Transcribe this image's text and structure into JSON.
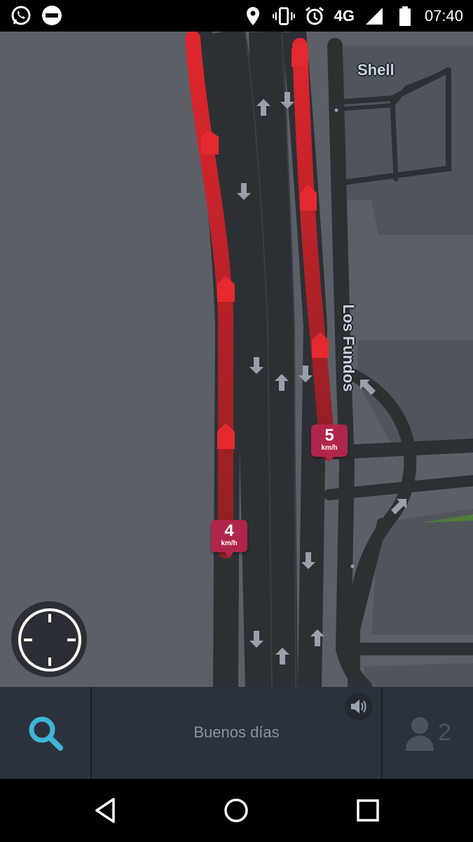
{
  "status_bar": {
    "left_icons": [
      "whatsapp-icon",
      "do-not-disturb-icon"
    ],
    "right_icons": [
      "location-icon",
      "vibrate-icon",
      "alarm-icon"
    ],
    "network": "4G",
    "time": "07:40"
  },
  "map": {
    "labels": {
      "shell": "Shell",
      "los_fundos": "Los Fundos"
    },
    "traffic_reports": [
      {
        "speed": "5",
        "unit": "km/h"
      },
      {
        "speed": "4",
        "unit": "km/h"
      }
    ],
    "colors": {
      "background": "#5b6066",
      "road": "#2c3035",
      "traffic_jam": "#c0252b",
      "park": "#4f7d3a"
    }
  },
  "bottom_bar": {
    "search_icon": "search-icon",
    "greeting": "Buenos días",
    "sound_icon": "speaker-icon",
    "friends_icon": "person-icon",
    "friends_count": "2",
    "accent_color": "#3fb6d6"
  },
  "nav_bar": {
    "buttons": [
      "back-icon",
      "home-icon",
      "recents-icon"
    ]
  }
}
